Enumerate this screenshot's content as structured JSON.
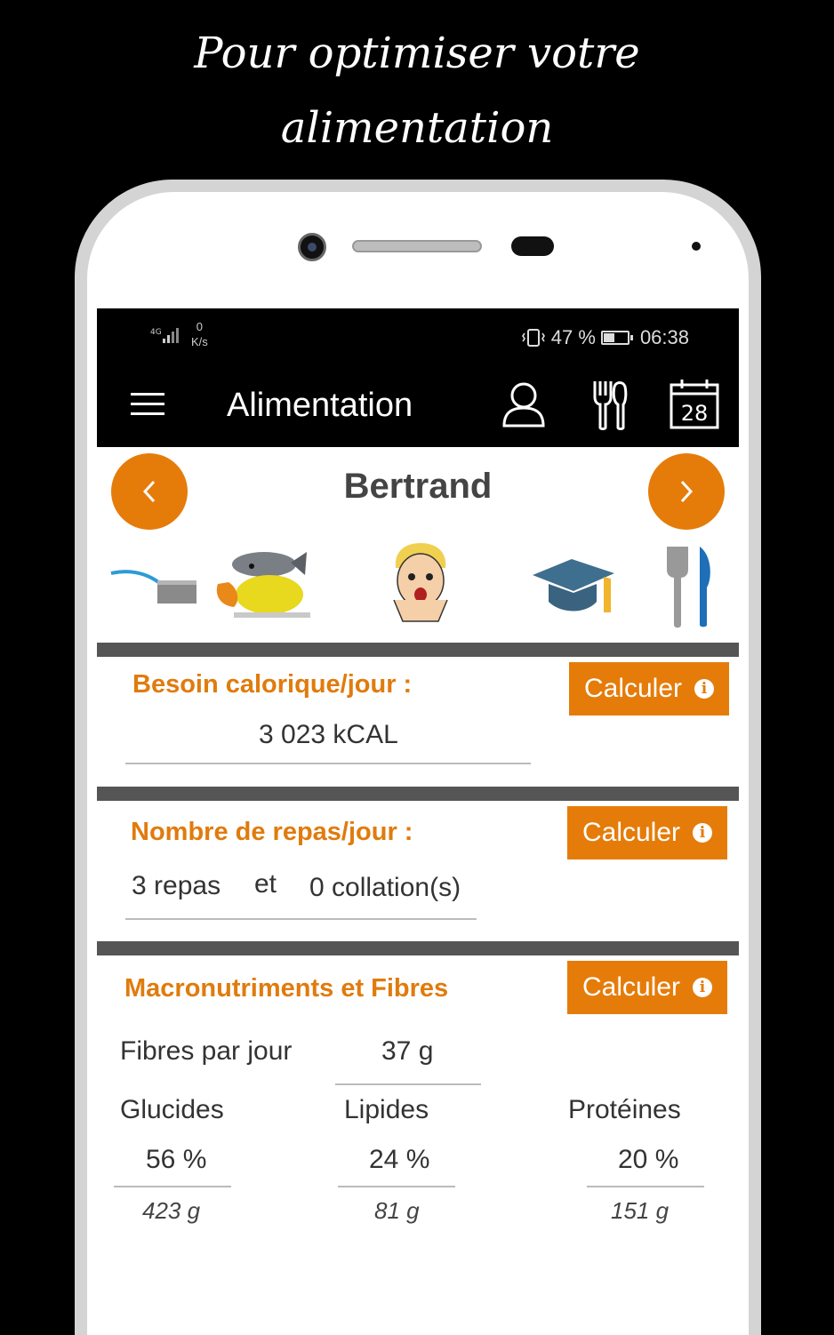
{
  "headline": {
    "line1": "Pour optimiser votre",
    "line2": "alimentation"
  },
  "status_bar": {
    "network": "4G",
    "speed_value": "0",
    "speed_unit": "K/s",
    "battery": "47 %",
    "time": "06:38"
  },
  "app_bar": {
    "title": "Alimentation",
    "icons": [
      "menu-icon",
      "user-icon",
      "cutlery-icon",
      "calendar-icon"
    ],
    "calendar_day": "28"
  },
  "person": {
    "name": "Bertrand"
  },
  "image_icons": [
    "pan-icon",
    "fish-chicken-icon",
    "worried-face-icon",
    "graduation-cap-icon",
    "fork-knife-icon"
  ],
  "calories": {
    "label": "Besoin calorique/jour :",
    "value": "3 023 kCAL",
    "button": "Calculer"
  },
  "meals": {
    "label": "Nombre de repas/jour :",
    "repas": "3 repas",
    "et": "et",
    "collations": "0 collation(s)",
    "button": "Calculer"
  },
  "macros": {
    "label": "Macronutriments et Fibres",
    "button": "Calculer",
    "fibres_label": "Fibres par jour",
    "fibres_value": "37 g",
    "glucides": {
      "label": "Glucides",
      "percent": "56 %",
      "grams": "423 g"
    },
    "lipides": {
      "label": "Lipides",
      "percent": "24 %",
      "grams": "81 g"
    },
    "proteines": {
      "label": "Protéines",
      "percent": "20 %",
      "grams": "151 g"
    }
  },
  "colors": {
    "accent": "#e57c0a",
    "label_orange": "#e07b0d",
    "divider": "#555555"
  }
}
